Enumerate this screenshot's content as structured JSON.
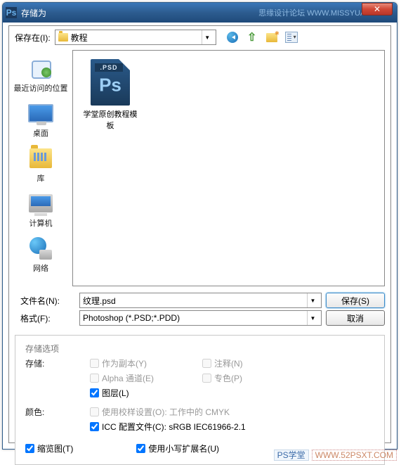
{
  "titlebar": {
    "icon_text": "Ps",
    "title": "存储为",
    "watermark": "思缘设计论坛 WWW.MISSYUAN.COM",
    "close": "✕"
  },
  "toolbar": {
    "save_in_label": "保存在(I):",
    "location": "教程"
  },
  "sidebar": {
    "items": [
      {
        "label": "最近访问的位置"
      },
      {
        "label": "桌面"
      },
      {
        "label": "库"
      },
      {
        "label": "计算机"
      },
      {
        "label": "网络"
      }
    ]
  },
  "file_area": {
    "items": [
      {
        "label": "学堂原创教程模板"
      }
    ]
  },
  "form": {
    "filename_label": "文件名(N):",
    "filename_value": "纹理.psd",
    "format_label": "格式(F):",
    "format_value": "Photoshop (*.PSD;*.PDD)",
    "save_btn": "保存(S)",
    "cancel_btn": "取消"
  },
  "options": {
    "title": "存储选项",
    "save_label": "存储:",
    "chk_copy": "作为副本(Y)",
    "chk_notes": "注释(N)",
    "chk_alpha": "Alpha 通道(E)",
    "chk_spot": "专色(P)",
    "chk_layers": "图层(L)",
    "color_label": "颜色:",
    "chk_proof": "使用校样设置(O): 工作中的 CMYK",
    "chk_icc": "ICC 配置文件(C): sRGB IEC61966-2.1",
    "chk_thumb": "缩览图(T)",
    "chk_lowercase": "使用小写扩展名(U)"
  },
  "footer": {
    "wm1": "PS学堂",
    "wm2": "WWW.52PSXT.COM"
  }
}
